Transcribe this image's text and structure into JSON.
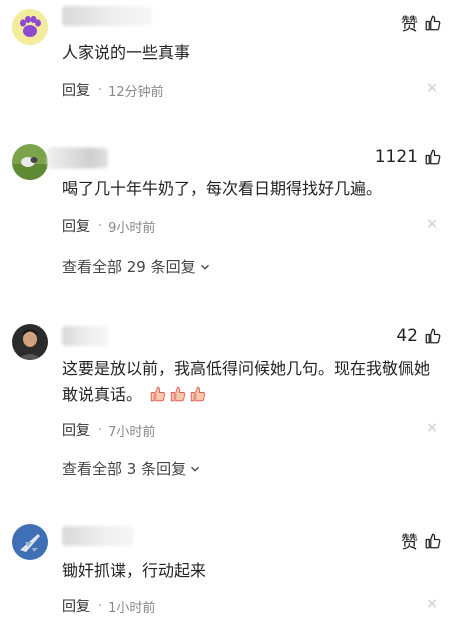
{
  "comments": [
    {
      "like_label": "赞",
      "text": "人家说的一些真事",
      "reply_label": "回复",
      "dot": "·",
      "time": "12分钟前",
      "close": "×"
    },
    {
      "like_label": "1121",
      "text": "喝了几十年牛奶了，每次看日期得找好几遍。",
      "reply_label": "回复",
      "dot": "·",
      "time": "9小时前",
      "close": "×",
      "more_replies": "查看全部 29 条回复"
    },
    {
      "like_label": "42",
      "text": "这要是放以前，我高低得问候她几句。现在我敬佩她敢说真话。",
      "reply_label": "回复",
      "dot": "·",
      "time": "7小时前",
      "close": "×",
      "more_replies": "查看全部 3 条回复"
    },
    {
      "like_label": "赞",
      "text": "锄奸抓谍，行动起来",
      "reply_label": "回复",
      "dot": "·",
      "time": "1小时前",
      "close": "×"
    }
  ],
  "icons": {
    "like": "thumbs-up-icon",
    "chevron": "chevron-down-icon",
    "emoji": "thumbs-up-emoji"
  }
}
